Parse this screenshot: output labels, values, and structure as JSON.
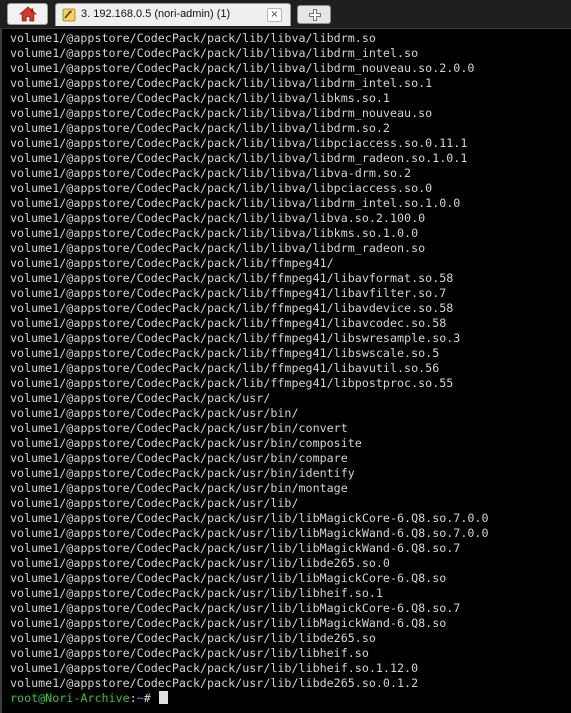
{
  "tabs": {
    "active_title": "3. 192.168.0.5 (nori-admin) (1)",
    "close_glyph": "×"
  },
  "terminal": {
    "lines": [
      "volume1/@appstore/CodecPack/pack/lib/libva/libdrm.so",
      "volume1/@appstore/CodecPack/pack/lib/libva/libdrm_intel.so",
      "volume1/@appstore/CodecPack/pack/lib/libva/libdrm_nouveau.so.2.0.0",
      "volume1/@appstore/CodecPack/pack/lib/libva/libdrm_intel.so.1",
      "volume1/@appstore/CodecPack/pack/lib/libva/libkms.so.1",
      "volume1/@appstore/CodecPack/pack/lib/libva/libdrm_nouveau.so",
      "volume1/@appstore/CodecPack/pack/lib/libva/libdrm.so.2",
      "volume1/@appstore/CodecPack/pack/lib/libva/libpciaccess.so.0.11.1",
      "volume1/@appstore/CodecPack/pack/lib/libva/libdrm_radeon.so.1.0.1",
      "volume1/@appstore/CodecPack/pack/lib/libva/libva-drm.so.2",
      "volume1/@appstore/CodecPack/pack/lib/libva/libpciaccess.so.0",
      "volume1/@appstore/CodecPack/pack/lib/libva/libdrm_intel.so.1.0.0",
      "volume1/@appstore/CodecPack/pack/lib/libva/libva.so.2.100.0",
      "volume1/@appstore/CodecPack/pack/lib/libva/libkms.so.1.0.0",
      "volume1/@appstore/CodecPack/pack/lib/libva/libdrm_radeon.so",
      "volume1/@appstore/CodecPack/pack/lib/ffmpeg41/",
      "volume1/@appstore/CodecPack/pack/lib/ffmpeg41/libavformat.so.58",
      "volume1/@appstore/CodecPack/pack/lib/ffmpeg41/libavfilter.so.7",
      "volume1/@appstore/CodecPack/pack/lib/ffmpeg41/libavdevice.so.58",
      "volume1/@appstore/CodecPack/pack/lib/ffmpeg41/libavcodec.so.58",
      "volume1/@appstore/CodecPack/pack/lib/ffmpeg41/libswresample.so.3",
      "volume1/@appstore/CodecPack/pack/lib/ffmpeg41/libswscale.so.5",
      "volume1/@appstore/CodecPack/pack/lib/ffmpeg41/libavutil.so.56",
      "volume1/@appstore/CodecPack/pack/lib/ffmpeg41/libpostproc.so.55",
      "volume1/@appstore/CodecPack/pack/usr/",
      "volume1/@appstore/CodecPack/pack/usr/bin/",
      "volume1/@appstore/CodecPack/pack/usr/bin/convert",
      "volume1/@appstore/CodecPack/pack/usr/bin/composite",
      "volume1/@appstore/CodecPack/pack/usr/bin/compare",
      "volume1/@appstore/CodecPack/pack/usr/bin/identify",
      "volume1/@appstore/CodecPack/pack/usr/bin/montage",
      "volume1/@appstore/CodecPack/pack/usr/lib/",
      "volume1/@appstore/CodecPack/pack/usr/lib/libMagickCore-6.Q8.so.7.0.0",
      "volume1/@appstore/CodecPack/pack/usr/lib/libMagickWand-6.Q8.so.7.0.0",
      "volume1/@appstore/CodecPack/pack/usr/lib/libMagickWand-6.Q8.so.7",
      "volume1/@appstore/CodecPack/pack/usr/lib/libde265.so.0",
      "volume1/@appstore/CodecPack/pack/usr/lib/libMagickCore-6.Q8.so",
      "volume1/@appstore/CodecPack/pack/usr/lib/libheif.so.1",
      "volume1/@appstore/CodecPack/pack/usr/lib/libMagickCore-6.Q8.so.7",
      "volume1/@appstore/CodecPack/pack/usr/lib/libMagickWand-6.Q8.so",
      "volume1/@appstore/CodecPack/pack/usr/lib/libde265.so",
      "volume1/@appstore/CodecPack/pack/usr/lib/libheif.so",
      "volume1/@appstore/CodecPack/pack/usr/lib/libheif.so.1.12.0",
      "volume1/@appstore/CodecPack/pack/usr/lib/libde265.so.0.1.2"
    ],
    "prompt": {
      "user_host": "root@Nori-Archive",
      "separator": ":",
      "path": "~",
      "symbol": "# "
    }
  },
  "colors": {
    "background": "#000000",
    "text": "#d4d4d4",
    "prompt_user": "#3ec03e",
    "prompt_path": "#6a7cff",
    "tab_bar": "#1f1f1f"
  },
  "icons": {
    "home": "home-icon",
    "tab": "terminal-session-icon",
    "new_tab": "plus-icon"
  }
}
